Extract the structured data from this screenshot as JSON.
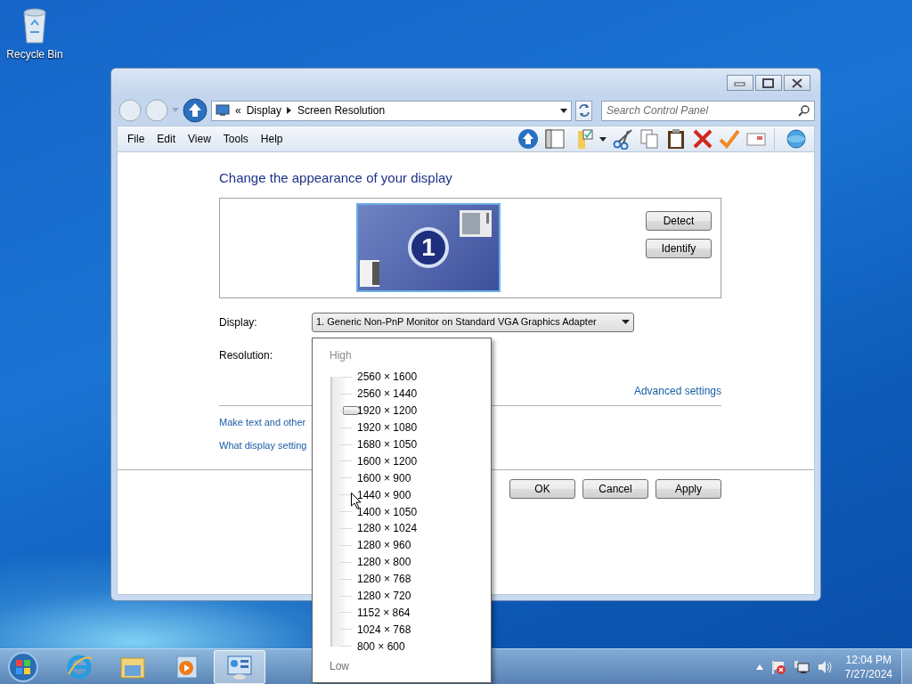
{
  "desktop_icons": [
    {
      "label": "Recycle Bin"
    }
  ],
  "address": {
    "prefix": "«",
    "crumbs": [
      "Display",
      "Screen Resolution"
    ]
  },
  "search": {
    "placeholder": "Search Control Panel"
  },
  "menu": [
    "File",
    "Edit",
    "View",
    "Tools",
    "Help"
  ],
  "heading": "Change the appearance of your display",
  "monitor": {
    "number": "1"
  },
  "side_buttons": [
    "Detect",
    "Identify"
  ],
  "display": {
    "label": "Display:",
    "value": "1. Generic Non-PnP Monitor on Standard VGA Graphics Adapter"
  },
  "resolution": {
    "label": "Resolution:"
  },
  "advanced_link": "Advanced settings",
  "links": [
    "Make text and other",
    "What display setting"
  ],
  "dialog_buttons": [
    "OK",
    "Cancel",
    "Apply"
  ],
  "resolution_popup": {
    "high_label": "High",
    "low_label": "Low",
    "level": 0.875,
    "options": [
      "2560 × 1600",
      "2560 × 1440",
      "1920 × 1200",
      "1920 × 1080",
      "1680 × 1050",
      "1600 × 1200",
      "1600 × 900",
      "1440 × 900",
      "1400 × 1050",
      "1280 × 1024",
      "1280 × 960",
      "1280 × 800",
      "1280 × 768",
      "1280 × 720",
      "1152 × 864",
      "1024 × 768",
      "800 × 600"
    ]
  },
  "taskbar": {
    "apps": [
      {
        "kind": "browser",
        "selected": false
      },
      {
        "kind": "folder",
        "selected": false
      },
      {
        "kind": "player",
        "selected": false
      },
      {
        "kind": "control",
        "selected": true
      }
    ],
    "clock": {
      "time": "12:04 PM",
      "date": "7/27/2024"
    }
  }
}
